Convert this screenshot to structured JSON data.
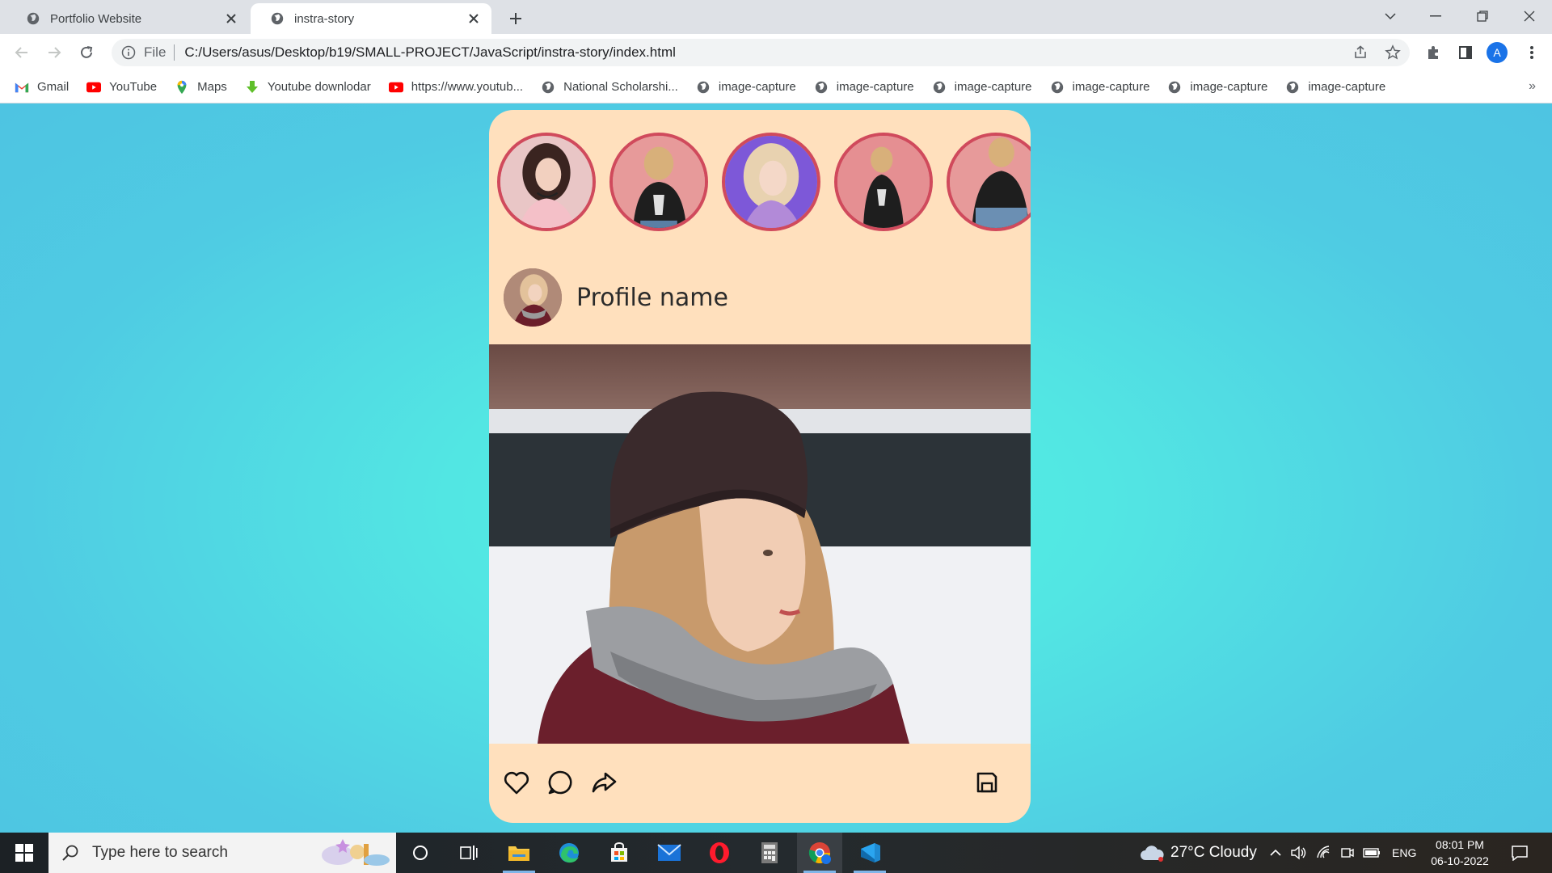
{
  "browser": {
    "tabs": [
      {
        "title": "Portfolio Website",
        "active": false
      },
      {
        "title": "instra-story",
        "active": true
      }
    ],
    "address": {
      "scheme": "File",
      "url": "C:/Users/asus/Desktop/b19/SMALL-PROJECT/JavaScript/instra-story/index.html"
    },
    "profile_initial": "A",
    "bookmarks": [
      {
        "label": "Gmail",
        "icon": "gmail-icon"
      },
      {
        "label": "YouTube",
        "icon": "youtube-icon"
      },
      {
        "label": "Maps",
        "icon": "maps-icon"
      },
      {
        "label": "Youtube downlodar",
        "icon": "download-icon"
      },
      {
        "label": "https://www.youtub...",
        "icon": "youtube-icon"
      },
      {
        "label": "National Scholarshi...",
        "icon": "globe-icon"
      },
      {
        "label": "image-capture",
        "icon": "globe-icon"
      },
      {
        "label": "image-capture",
        "icon": "globe-icon"
      },
      {
        "label": "image-capture",
        "icon": "globe-icon"
      },
      {
        "label": "image-capture",
        "icon": "globe-icon"
      },
      {
        "label": "image-capture",
        "icon": "globe-icon"
      },
      {
        "label": "image-capture",
        "icon": "globe-icon"
      }
    ],
    "bookmarks_more": "»"
  },
  "page": {
    "profile_name": "Profile name",
    "story_count": 5,
    "actions": [
      "heart-icon",
      "comment-icon",
      "share-icon",
      "save-icon"
    ]
  },
  "taskbar": {
    "search_placeholder": "Type here to search",
    "weather": "27°C  Cloudy",
    "language": "ENG",
    "time": "08:01 PM",
    "date": "06-10-2022"
  },
  "colors": {
    "card_bg": "#ffe0bd",
    "story_ring": "#d04a5c",
    "page_bg": "#52e6e3"
  }
}
